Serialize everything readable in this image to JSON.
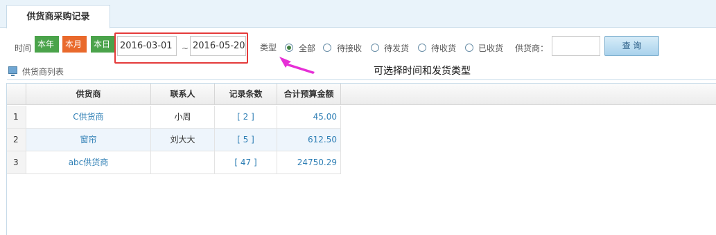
{
  "tab": {
    "title": "供货商采购记录"
  },
  "filter": {
    "time_label": "时间",
    "quick": [
      {
        "label": "本年",
        "color": "#4aa34a"
      },
      {
        "label": "本月",
        "color": "#e9692c"
      },
      {
        "label": "本日",
        "color": "#4aa34a"
      }
    ],
    "date_from": "2016-03-01",
    "separator": "~",
    "date_to": "2016-05-20",
    "type_label": "类型",
    "types": [
      {
        "label": "全部",
        "checked": true
      },
      {
        "label": "待接收",
        "checked": false
      },
      {
        "label": "待发货",
        "checked": false
      },
      {
        "label": "待收货",
        "checked": false
      },
      {
        "label": "已收货",
        "checked": false
      }
    ],
    "supplier_label": "供货商：",
    "supplier_value": "",
    "query_label": "查 询"
  },
  "annotation": {
    "text": "可选择时间和发货类型",
    "highlight_color": "#e43a3a",
    "arrow_color": "#e62fd6"
  },
  "list": {
    "title": "供货商列表"
  },
  "table": {
    "columns": [
      "",
      "供货商",
      "联系人",
      "记录条数",
      "合计预算金额"
    ],
    "rows": [
      {
        "index": "1",
        "supplier": "C供货商",
        "contact": "小周",
        "records": "[ 2 ]",
        "amount": "45.00"
      },
      {
        "index": "2",
        "supplier": "窗帘",
        "contact": "刘大大",
        "records": "[ 5 ]",
        "amount": "612.50"
      },
      {
        "index": "3",
        "supplier": "abc供货商",
        "contact": "",
        "records": "[ 47 ]",
        "amount": "24750.29"
      }
    ]
  }
}
